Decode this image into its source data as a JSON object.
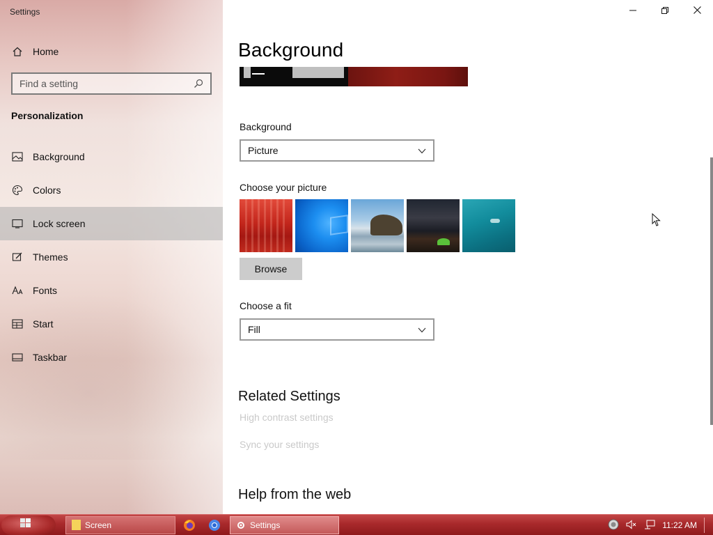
{
  "window": {
    "app_title": "Settings",
    "minimize_icon": "minimize-icon",
    "restore_icon": "restore-icon",
    "close_icon": "close-icon"
  },
  "sidebar": {
    "home_label": "Home",
    "search_placeholder": "Find a setting",
    "section_heading": "Personalization",
    "items": [
      {
        "label": "Background",
        "icon": "image-icon"
      },
      {
        "label": "Colors",
        "icon": "palette-icon"
      },
      {
        "label": "Lock screen",
        "icon": "lock-screen-icon"
      },
      {
        "label": "Themes",
        "icon": "themes-icon"
      },
      {
        "label": "Fonts",
        "icon": "fonts-icon"
      },
      {
        "label": "Start",
        "icon": "start-icon"
      },
      {
        "label": "Taskbar",
        "icon": "taskbar-icon"
      }
    ],
    "selected_item": "Lock screen"
  },
  "main": {
    "page_title": "Background",
    "background_label": "Background",
    "background_value": "Picture",
    "choose_picture_label": "Choose your picture",
    "browse_label": "Browse",
    "choose_fit_label": "Choose a fit",
    "fit_value": "Fill",
    "related_heading": "Related Settings",
    "related_links": [
      "High contrast settings",
      "Sync your settings"
    ],
    "help_heading": "Help from the web"
  },
  "taskbar": {
    "screen_label": "Screen",
    "settings_label": "Settings",
    "time": "11:22 AM",
    "colors": {
      "bar": "#a8292b",
      "accent": "#c24646"
    }
  }
}
